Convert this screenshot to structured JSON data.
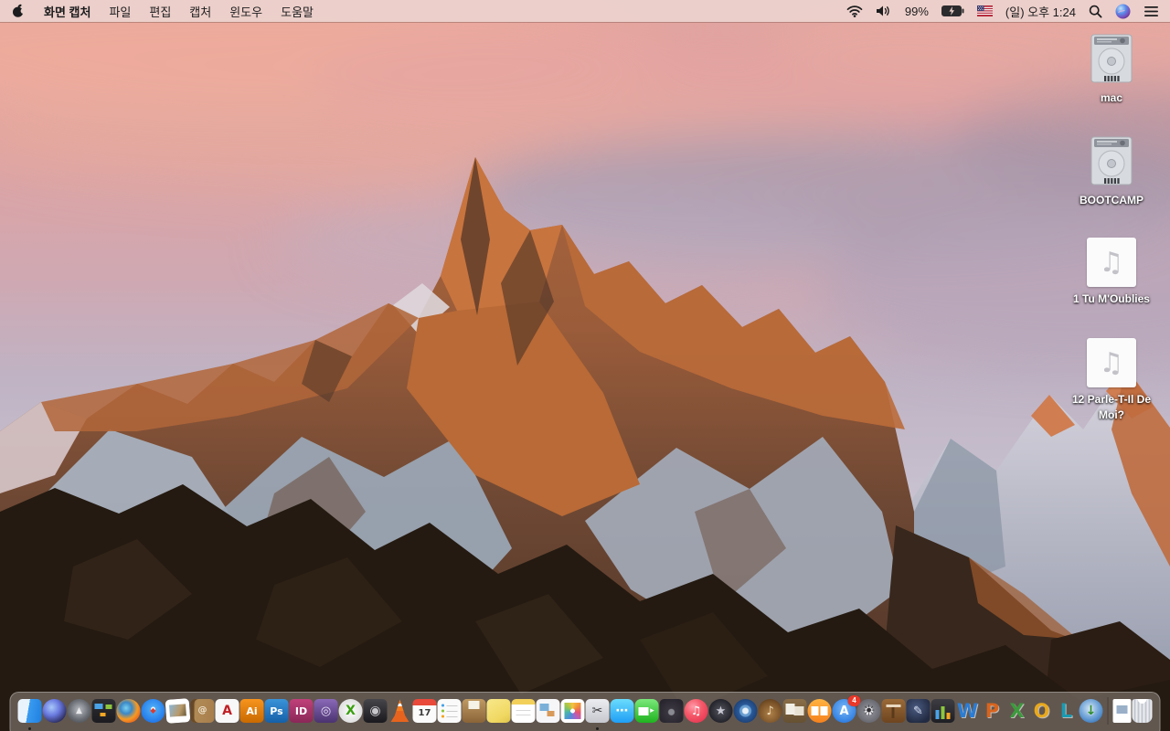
{
  "menu_bar": {
    "app_name": "화면 캡처",
    "menus": [
      {
        "id": "file",
        "label": "파일"
      },
      {
        "id": "edit",
        "label": "편집"
      },
      {
        "id": "capture",
        "label": "캡처"
      },
      {
        "id": "window",
        "label": "윈도우"
      },
      {
        "id": "help",
        "label": "도움말"
      }
    ],
    "status": {
      "battery_percent": "99%",
      "clock": "(일) 오후 1:24",
      "icons": [
        "wifi",
        "volume",
        "battery-charging",
        "us-flag",
        "spotlight-search",
        "siri",
        "notification-center"
      ]
    }
  },
  "desktop": {
    "icons": [
      {
        "type": "hard-drive",
        "label": "mac"
      },
      {
        "type": "hard-drive",
        "label": "BOOTCAMP"
      },
      {
        "type": "audio-file",
        "label": "1 Tu M'Oublies"
      },
      {
        "type": "audio-file",
        "label": "12 Parle-T-Il De Moi?"
      }
    ]
  },
  "colors": {
    "menubar_bg": "#ebd1cb",
    "dock_bg": "rgba(148,138,132,0.55)",
    "sky_pink": "#e2a59e",
    "sky_lavender": "#c8c1cf",
    "rock_orange": "#b96a36",
    "foreground_rock": "#241a11",
    "badge_red": "#e8382a"
  },
  "dock": {
    "items": [
      {
        "name": "finder",
        "shape": "square",
        "running": true,
        "bg": "linear-gradient(100deg,#e9f3fc 0%,#e9f3fc 44%,#3a9bf0 44%,#1f7fe0 100%)"
      },
      {
        "name": "siri",
        "shape": "round",
        "bg": "radial-gradient(circle at 38% 35%,#a8c8f8 0%,#6a7ae0 38%,#2a2a5a 78%,#191938 100%)"
      },
      {
        "name": "launchpad",
        "shape": "round",
        "bg": "radial-gradient(circle at 50% 45%,#b8bcc2 0%,#6a6e74 55%,#3a3d42 100%)",
        "glyph": "▲",
        "glyphColor": "#e8e8ea",
        "glyphSize": 9
      },
      {
        "name": "mission-control",
        "shape": "square",
        "bg": "#26262a",
        "css": "background-image:linear-gradient(#4aa3e8,#4aa3e8),linear-gradient(#8cc63f,#8cc63f),linear-gradient(#f5a623,#f5a623),linear-gradient(#2e2e32,#1c1c20);background-size:9px 6px,7px 5px,6px 4px,100% 100%;background-position:3px 5px,15px 6px,9px 15px,0 0;background-repeat:no-repeat"
      },
      {
        "name": "firefox",
        "shape": "round",
        "bg": "radial-gradient(circle at 40% 38%,#7ad0f0 0%,#3a88c8 28%,#f59a23 55%,#e8641e 78%,#c44a10 100%)"
      },
      {
        "name": "safari",
        "shape": "round",
        "bg": "radial-gradient(circle at 50% 42%,#f0f6fa 0%,#f0f6fa 10%,#4aa8f5 14%,#1a6fe8 85%)",
        "glyph": "◆",
        "glyphColor": "#e03a2a",
        "glyphSize": 8
      },
      {
        "name": "photo-viewer",
        "shape": "square",
        "bg": "#ffffff",
        "css": "background-image:linear-gradient(115deg,#8ab6d8 0%,#b99a6a 60%,#6a5a3a 100%),linear-gradient(#fff,#fff);background-size:18px 13px,100% 100%;background-position:4px 6px,0 0;background-repeat:no-repeat;transform:rotate(-4deg)"
      },
      {
        "name": "contacts",
        "shape": "square",
        "bg": "linear-gradient(100deg,#8a6a40 0%,#b08a55 25%,#a87e4c 100%)",
        "css": "box-shadow:inset 4px 0 0 rgba(90,60,30,.8)",
        "glyph": "@",
        "glyphColor": "#f0e4d0",
        "glyphSize": 10
      },
      {
        "name": "acrobat-reader",
        "shape": "square",
        "bg": "#f8f8f8",
        "glyph": "A",
        "glyphColor": "#c01f25",
        "glyphSize": 14
      },
      {
        "name": "illustrator",
        "shape": "square",
        "bg": "linear-gradient(#f7941e,#c96a00)",
        "glyph": "Ai",
        "glyphColor": "#ffffff",
        "glyphSize": 11
      },
      {
        "name": "photoshop",
        "shape": "square",
        "bg": "linear-gradient(#3a93d8,#1660a8)",
        "glyph": "Ps",
        "glyphColor": "#ffffff",
        "glyphSize": 11
      },
      {
        "name": "indesign",
        "shape": "square",
        "bg": "linear-gradient(#c0407a,#8a2858)",
        "glyph": "ID",
        "glyphColor": "#ffffff",
        "glyphSize": 11
      },
      {
        "name": "toast",
        "shape": "square",
        "bg": "linear-gradient(#8a68b8,#4a3370)",
        "glyph": "◎",
        "glyphColor": "#e8e0f5",
        "glyphSize": 13
      },
      {
        "name": "green-x-app",
        "shape": "round",
        "bg": "radial-gradient(circle,#fdfdfd 0%,#e0e0e0 70%,#b8b8b8 100%)",
        "glyph": "X",
        "glyphColor": "#3aa010",
        "glyphSize": 14
      },
      {
        "name": "disk-utility-app",
        "shape": "square",
        "bg": "linear-gradient(#46464a,#1a1a1e)",
        "glyph": "◉",
        "glyphColor": "#c8c8cc",
        "glyphSize": 14
      },
      {
        "name": "vlc",
        "shape": "square",
        "bg": "repeating-linear-gradient(180deg,#f57b1e 0 5px,#ffffff 5px 8px,#f57b1e 8px 13px,#e8641e 13px 26px)",
        "css": "clip-path:polygon(50% 2%,72% 70%,88% 96%,12% 96%,28% 70%)"
      },
      {
        "name": "calendar",
        "shape": "square",
        "bg": "#fbfbfb",
        "css": "background-image:linear-gradient(#e8493a,#e8493a),linear-gradient(#fbfbfb,#fbfbfb);background-size:100% 7px,100% 100%;background-position:0 0,0 0;background-repeat:no-repeat",
        "glyph": "17",
        "glyphColor": "#3a3a3c",
        "glyphSize": 10,
        "glyphCss": "margin-top:6px"
      },
      {
        "name": "reminders",
        "shape": "square",
        "bg": "#fafafa",
        "css": "background-image:radial-gradient(1.5px at 6px 7px,#4aa3e8 98%,transparent),radial-gradient(1.5px at 6px 13px,#8cc63f 98%,transparent),radial-gradient(1.5px at 6px 19px,#f5a623 98%,transparent),linear-gradient(#ccc,#ccc),linear-gradient(#ccc,#ccc),linear-gradient(#ccc,#ccc),linear-gradient(#fafafa,#fafafa);background-size:auto,auto,auto,12px 1px,12px 1px,12px 1px,100% 100%;background-position:0 0,0 0,0 0,10px 7px,10px 13px,10px 19px,0 0;background-repeat:no-repeat"
      },
      {
        "name": "archive-box-app",
        "shape": "square",
        "bg": "linear-gradient(#c09a62,#8a6438)",
        "css": "background-image:linear-gradient(#f5f2e8,#f5f2e8),linear-gradient(#c09a62,#8a6438);background-size:12px 9px,100% 100%;background-position:7px 2px,0 0;background-repeat:no-repeat"
      },
      {
        "name": "stickies",
        "shape": "square",
        "bg": "linear-gradient(150deg,#f8e88a 0%,#f0d862 70%,#e0c44a 100%)"
      },
      {
        "name": "notes",
        "shape": "square",
        "bg": "#ffffff",
        "css": "background-image:linear-gradient(#f2d05a,#f2d05a),linear-gradient(#d8d8d8,#d8d8d8),linear-gradient(#d8d8d8,#d8d8d8),linear-gradient(#fff,#fff);background-size:100% 6px,16px 1px,16px 1px,100% 100%;background-position:0 0,5px 12px,5px 17px,0 0;background-repeat:no-repeat"
      },
      {
        "name": "preview",
        "shape": "square",
        "bg": "#f6f6f8",
        "css": "background-image:linear-gradient(#7ab0d8,#7ab0d8),linear-gradient(#d89a5a,#d89a5a),linear-gradient(#f6f6f8,#f6f6f8);background-size:10px 8px,8px 6px,100% 100%;background-position:4px 5px,12px 13px,0 0;background-repeat:no-repeat"
      },
      {
        "name": "photos",
        "shape": "square",
        "bg": "#ffffff",
        "css": "background-image:radial-gradient(2.5px at 50% 50%,#fff 98%,transparent),conic-gradient(from 0deg,#f5c242,#ef8c3c,#e8536f,#a862c9,#4a90d9,#4ab7a8,#9cc74a,#f5c242);background-size:auto,18px 18px;background-position:center,center;background-repeat:no-repeat;border-radius:22%"
      },
      {
        "name": "screen-capture-grab",
        "shape": "square",
        "running": true,
        "bg": "linear-gradient(#ecedf0,#c6c8cf)",
        "glyph": "✂",
        "glyphColor": "#3a3a3c",
        "glyphSize": 14
      },
      {
        "name": "messages",
        "shape": "square",
        "bg": "linear-gradient(#6adcfc,#1f9ef5)",
        "css": "border-radius:7px",
        "glyph": "⋯",
        "glyphColor": "#ffffff",
        "glyphSize": 14
      },
      {
        "name": "facetime",
        "shape": "square",
        "bg": "linear-gradient(#7ae87a,#1fb31f)",
        "css": "border-radius:7px;background-image:linear-gradient(#fff,#fff),linear-gradient(#7ae87a,#1fb31f);background-size:11px 9px,100% 100%;background-position:4px 9px,0 0;background-repeat:no-repeat",
        "glyph": "▸",
        "glyphColor": "#ffffff",
        "glyphSize": 9,
        "glyphCss": "margin-left:12px"
      },
      {
        "name": "photo-booth",
        "shape": "square",
        "bg": "radial-gradient(circle at 50% 55%,#8a8a92 0 3px,#3a3640 4px,#221f28 100%)"
      },
      {
        "name": "itunes",
        "shape": "round",
        "bg": "radial-gradient(circle at 38% 32%,#ff9aa8 0%,#f55a6a 40%,#e02848 100%)",
        "glyph": "♫",
        "glyphColor": "#ffffff",
        "glyphSize": 13
      },
      {
        "name": "imovie",
        "shape": "round",
        "bg": "radial-gradient(circle,#54545e 0%,#1c1c24 80%)",
        "glyph": "★",
        "glyphColor": "#c8c8d2",
        "glyphSize": 13
      },
      {
        "name": "dvd-app",
        "shape": "round",
        "bg": "radial-gradient(circle at 50% 50%,#e8f0f8 0 3px,#6a9ed0 4px 6px,#2a5a9a 7px,#152f5a 100%)"
      },
      {
        "name": "garageband",
        "shape": "round",
        "bg": "radial-gradient(circle at 50% 60%,#b0824a 0%,#7a5228 60%,#4a2e12 100%)",
        "glyph": "♪",
        "glyphColor": "#f0ddb8",
        "glyphSize": 13
      },
      {
        "name": "scrapbook-app",
        "shape": "square",
        "bg": "linear-gradient(#8a6e48,#655032)",
        "css": "background-image:linear-gradient(#f2efe6,#f2efe6),linear-gradient(#e8e2d2,#e8e2d2),linear-gradient(#8a6e48,#655032);background-size:10px 12px,11px 10px,100% 100%;background-position:3px 5px,12px 8px,0 0;background-repeat:no-repeat"
      },
      {
        "name": "ibooks",
        "shape": "round",
        "bg": "linear-gradient(#ffb340,#f5821e)",
        "css": "background-image:linear-gradient(#fff,#fff),linear-gradient(#fff,#fff),linear-gradient(#ffb340,#f5821e);background-size:8px 10px,8px 10px,100% 100%;background-position:4px 8px,14px 8px,0 0;background-repeat:no-repeat"
      },
      {
        "name": "app-store",
        "shape": "round",
        "bg": "radial-gradient(circle at 50% 40%,#7ab8f8 0%,#2a7ae0 80%)",
        "glyph": "A",
        "glyphColor": "#ffffff",
        "glyphSize": 13,
        "badge": "4"
      },
      {
        "name": "system-preferences",
        "shape": "round",
        "bg": "radial-gradient(circle at 50% 50%,#e8e8ec 0 4px,#86868e 5px,#55555d 100%)",
        "glyph": "☀",
        "glyphColor": "#2e2e33",
        "glyphSize": 16
      },
      {
        "name": "keynote",
        "shape": "square",
        "bg": "linear-gradient(#9a6a38,#6e4520)",
        "css": "background-image:linear-gradient(#e8d8c0,#e8d8c0),linear-gradient(#5a3a1a,#5a3a1a),linear-gradient(#9a6a38,#6e4520);background-size:16px 3px,3px 12px,100% 100%;background-position:5px 6px,11px 9px,0 0;background-repeat:no-repeat"
      },
      {
        "name": "pages",
        "shape": "square",
        "bg": "radial-gradient(circle at 42% 38%,#4a5a80 0%,#222b42 75%)",
        "glyph": "✎",
        "glyphColor": "#d8e0f0",
        "glyphSize": 13
      },
      {
        "name": "numbers",
        "shape": "square",
        "bg": "linear-gradient(#3c3c42,#1e1e24)",
        "css": "background-image:linear-gradient(#4aa3e8,#4aa3e8),linear-gradient(#8cc63f,#8cc63f),linear-gradient(#f5a623,#f5a623),linear-gradient(#3c3c42,#1e1e24);background-size:4px 10px,4px 14px,4px 7px,100% 100%;background-position:5px 12px,11px 8px,17px 15px,0 0;background-repeat:no-repeat"
      },
      {
        "name": "word",
        "shape": "square",
        "bg": "none",
        "glyph": "W",
        "glyphColor": "#2b7cd3",
        "glyphSize": 21,
        "glyphCss": "text-shadow:1px 1px 0 rgba(255,255,255,.6)"
      },
      {
        "name": "powerpoint",
        "shape": "square",
        "bg": "none",
        "glyph": "P",
        "glyphColor": "#d8641e",
        "glyphSize": 21,
        "glyphCss": "text-shadow:1px 1px 0 rgba(255,255,255,.6)"
      },
      {
        "name": "excel",
        "shape": "square",
        "bg": "none",
        "glyph": "X",
        "glyphColor": "#3d9a3d",
        "glyphSize": 21,
        "glyphCss": "text-shadow:1px 1px 0 rgba(255,255,255,.6)"
      },
      {
        "name": "outlook",
        "shape": "square",
        "bg": "none",
        "glyph": "O",
        "glyphColor": "#e8a81e",
        "glyphSize": 21,
        "glyphCss": "text-shadow:1px 1px 0 rgba(255,255,255,.6)"
      },
      {
        "name": "lync",
        "shape": "square",
        "bg": "none",
        "glyph": "L",
        "glyphColor": "#1a9ab0",
        "glyphSize": 21,
        "glyphCss": "text-shadow:1px 1px 0 rgba(255,255,255,.6)"
      },
      {
        "name": "downloader-app",
        "shape": "round",
        "bg": "radial-gradient(circle at 45% 40%,#cfe4f5 0%,#5a94cf 60%,#2a5a9a 100%)",
        "glyph": "↓",
        "glyphColor": "#2a8a2a",
        "glyphSize": 14,
        "glyphCss": "text-shadow:0 0 2px #fff"
      },
      {
        "divider": true
      },
      {
        "name": "document-file",
        "shape": "square",
        "bg": "#ffffff",
        "css": "border-radius:2px;width:20px;background-image:linear-gradient(#9ab0c8,#9ab0c8),linear-gradient(#fff,#fff);background-size:12px 9px,100% 100%;background-position:center 7px,0 0;background-repeat:no-repeat"
      },
      {
        "name": "trash",
        "shape": "square",
        "bg": "repeating-linear-gradient(90deg,#eceef2 0 2px,#c2c6ce 2px 4px)",
        "css": "border-radius:3px 3px 7px 7px;width:22px;background-image:radial-gradient(5px at 50% 0,#ffffff 96%,transparent),repeating-linear-gradient(90deg,#eceef2 0 2px,#c2c6ce 2px 4px)"
      }
    ]
  }
}
